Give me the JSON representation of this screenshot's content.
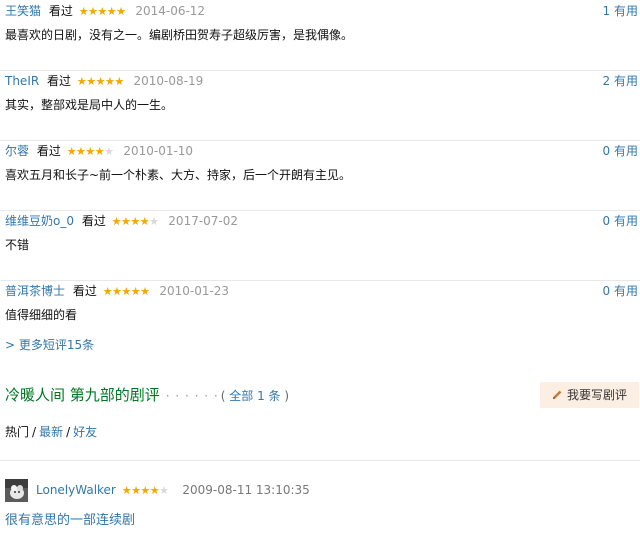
{
  "comments": [
    {
      "user": "王笑猫",
      "watched": "看过",
      "rating": 5,
      "date": "2014-06-12",
      "useful": "1 有用",
      "text": "最喜欢的日剧，没有之一。编剧桥田贺寿子超级厉害，是我偶像。"
    },
    {
      "user": "TheIR",
      "watched": "看过",
      "rating": 5,
      "date": "2010-08-19",
      "useful": "2 有用",
      "text": "其实，整部戏是局中人的一生。"
    },
    {
      "user": "尔蓉",
      "watched": "看过",
      "rating": 4,
      "date": "2010-01-10",
      "useful": "0 有用",
      "text": "喜欢五月和长子~前一个朴素、大方、持家，后一个开朗有主见。"
    },
    {
      "user": "维维豆奶o_0",
      "watched": "看过",
      "rating": 4,
      "date": "2017-07-02",
      "useful": "0 有用",
      "text": "不错"
    },
    {
      "user": "普洱茶博士",
      "watched": "看过",
      "rating": 5,
      "date": "2010-01-23",
      "useful": "0 有用",
      "text": "值得细细的看"
    }
  ],
  "more_comments": "> 更多短评15条",
  "reviews": {
    "title": "冷暖人间 第九部的剧评",
    "dots": "· · · · · ·",
    "count_prefix": "( ",
    "count_link": "全部 1 条",
    "count_suffix": " )",
    "write_label": "我要写剧评",
    "sort": [
      "热门",
      "最新",
      "好友"
    ],
    "sort_sep": "/"
  },
  "review": {
    "user": "LonelyWalker",
    "rating": 4,
    "date": "2009-08-11 13:10:35",
    "title": "很有意思的一部连续剧"
  },
  "icons": {
    "star": "star-icon",
    "pen": "pencil-icon"
  },
  "colors": {
    "link": "#3377aa",
    "star": "#f4a900",
    "reviews_title": "#007722",
    "write_button_bg": "#fbeee3"
  }
}
